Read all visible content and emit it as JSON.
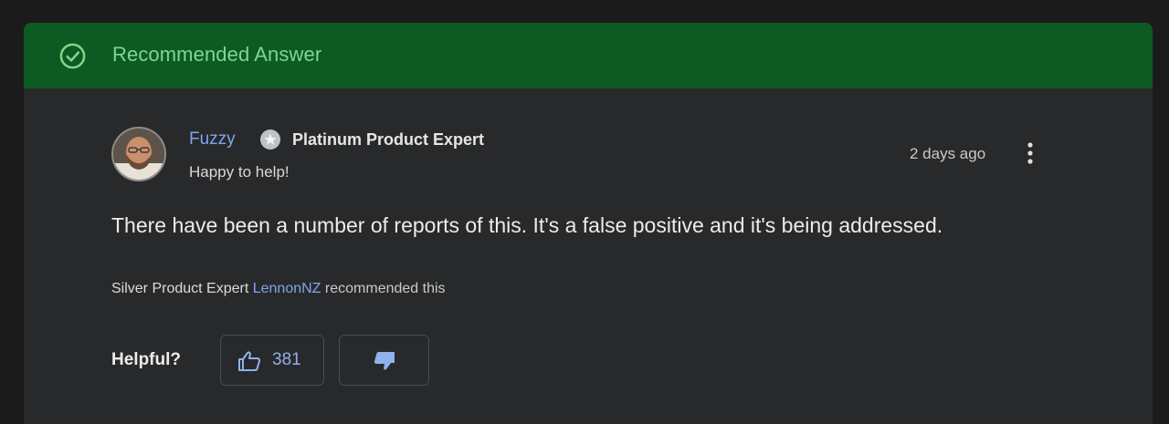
{
  "header": {
    "title": "Recommended Answer",
    "icon": "check-circle-icon",
    "accent_color": "#0d5b22"
  },
  "author": {
    "name": "Fuzzy",
    "badge_icon": "star-badge-icon",
    "badge_label": "Platinum Product Expert",
    "tagline": "Happy to help!"
  },
  "timestamp": "2 days ago",
  "answer": {
    "text": "There have been a number of reports of this. It's a false positive and it's being addressed."
  },
  "recommendation": {
    "role": "Silver Product Expert",
    "user": "LennonNZ",
    "suffix": "recommended this"
  },
  "feedback": {
    "label": "Helpful?",
    "upvote_count": "381"
  }
}
